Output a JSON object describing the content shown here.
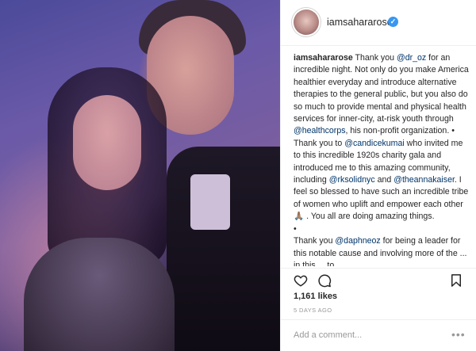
{
  "post": {
    "username": "iamsahararose",
    "verified_mark": "✓",
    "caption": {
      "author": "iamsahararose",
      "p1_a": " Thank you ",
      "m_dr_oz": "@dr_oz",
      "p1_b": " for an incredible night. Not only do you make America healthier everyday and introduce alternative therapies to the general public, but you also do so much to provide mental and physical health services for inner-city, at-risk youth through ",
      "m_healthcorps": "@healthcorps",
      "p1_c": ", his non-profit organization. •",
      "p2_a": "Thank you to ",
      "m_candicekumai": "@candicekumai",
      "p2_b": " who invited me to this incredible 1920s charity gala and introduced me to this amazing community, including ",
      "m_rksolidnyc": "@rksolidnyc",
      "p2_c": " and ",
      "m_theannakaiser": "@theannakaiser",
      "p2_d": ". I feel so blessed to have such an incredible tribe of women who uplift and empower each other🙏🏽 . You all are doing amazing things.",
      "bullet": "•",
      "p3_a": "Thank you ",
      "m_daphneoz": "@daphneoz",
      "p3_b": " for being a leader for this notable cause and involving more of the ... in this ... to ... "
    },
    "likes": "1,161 likes",
    "date": "5 DAYS AGO",
    "comment_placeholder": "Add a comment...",
    "more_glyph": "•••",
    "icons": {
      "like": "heart-icon",
      "comment": "comment-icon",
      "save": "bookmark-icon"
    }
  }
}
